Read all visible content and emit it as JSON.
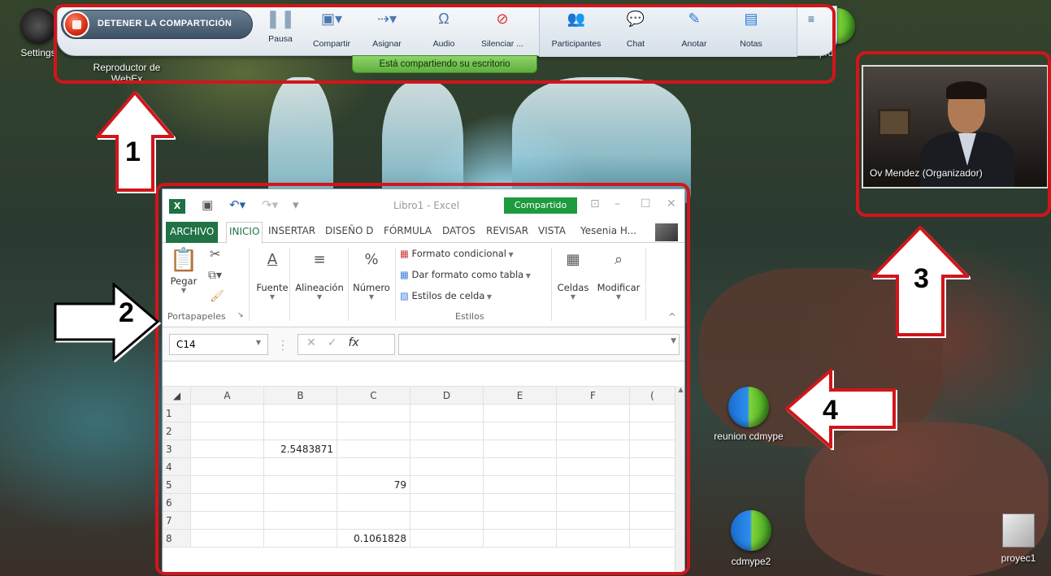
{
  "toolbar": {
    "stop_sharing_label": "DETENER LA COMPARTICIÓN",
    "buttons": [
      {
        "label": "Pausa",
        "icon": "pause-icon"
      },
      {
        "label": "Compartir",
        "icon": "share-icon"
      },
      {
        "label": "Asignar",
        "icon": "assign-icon"
      },
      {
        "label": "Audio",
        "icon": "headset-icon"
      },
      {
        "label": "Silenciar ...",
        "icon": "mute-mic-icon"
      },
      {
        "label": "Participantes",
        "icon": "participants-icon"
      },
      {
        "label": "Chat",
        "icon": "chat-icon"
      },
      {
        "label": "Anotar",
        "icon": "pencil-icon"
      },
      {
        "label": "Notas",
        "icon": "notes-icon"
      }
    ],
    "sharing_banner": "Está compartiendo su escritorio"
  },
  "desktop": {
    "icons": [
      {
        "label": "Settings"
      },
      {
        "label": "Reproductor de WebEx"
      },
      {
        "label": "pru"
      },
      {
        "label": "reunion cdmype"
      },
      {
        "label": "cdmype2"
      },
      {
        "label": "proyec1"
      }
    ]
  },
  "annotations": {
    "numbers": [
      "1",
      "2",
      "3",
      "4"
    ],
    "color": "#d0161b"
  },
  "excel": {
    "title": "Libro1 - Excel",
    "shared_badge": "Compartido",
    "tabs": [
      "ARCHIVO",
      "INICIO",
      "INSERTAR",
      "DISEÑO D",
      "FÓRMULA",
      "DATOS",
      "REVISAR",
      "VISTA"
    ],
    "user": "Yesenia H...",
    "ribbon": {
      "paste": "Pegar",
      "clipboard_group": "Portapapeles",
      "font": "Fuente",
      "alignment": "Alineación",
      "number": "Número",
      "conditional_format": "Formato condicional",
      "format_as_table": "Dar formato como tabla",
      "cell_styles": "Estilos de celda",
      "styles_group": "Estilos",
      "cells": "Celdas",
      "modify": "Modificar"
    },
    "name_box": "C14",
    "fx_label": "fx",
    "columns": [
      "A",
      "B",
      "C",
      "D",
      "E",
      "F"
    ],
    "rows": [
      {
        "n": "1",
        "cells": [
          "",
          "",
          "",
          "",
          "",
          ""
        ]
      },
      {
        "n": "2",
        "cells": [
          "",
          "",
          "",
          "",
          "",
          ""
        ]
      },
      {
        "n": "3",
        "cells": [
          "",
          "2.5483871",
          "",
          "",
          "",
          ""
        ]
      },
      {
        "n": "4",
        "cells": [
          "",
          "",
          "",
          "",
          "",
          ""
        ]
      },
      {
        "n": "5",
        "cells": [
          "",
          "",
          "79",
          "",
          "",
          ""
        ]
      },
      {
        "n": "6",
        "cells": [
          "",
          "",
          "",
          "",
          "",
          ""
        ]
      },
      {
        "n": "7",
        "cells": [
          "",
          "",
          "",
          "",
          "",
          ""
        ]
      },
      {
        "n": "8",
        "cells": [
          "",
          "",
          "0.1061828",
          "",
          "",
          ""
        ]
      }
    ],
    "accent": "#217346"
  },
  "webcam": {
    "name": "Ov Mendez (Organizador)"
  }
}
